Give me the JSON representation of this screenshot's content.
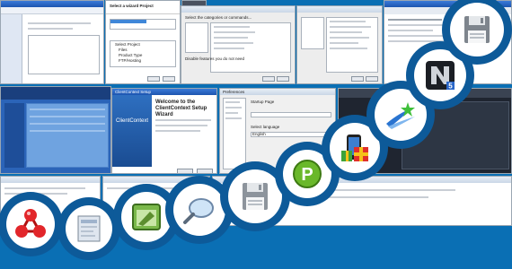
{
  "colors": {
    "background": "#0a6fb4",
    "ring": "#0d5a99",
    "window_titlebar": "#2a67c5"
  },
  "screens": {
    "project_wizard": {
      "title": "Select a wizard",
      "heading": "Select a wizard Project",
      "tree": [
        "Select Project",
        "Files",
        "Product Type",
        "FTP/Hosting"
      ]
    },
    "customize": {
      "question1": "Select the categories or commands...",
      "question2": "Disable features you do not need"
    },
    "setup": {
      "window_title": "ClientContext Setup",
      "logo_text": "ClientContext",
      "welcome_title": "Welcome to the ClientContext Setup Wizard",
      "buttons": [
        "Next >",
        "Cancel"
      ]
    },
    "preferences": {
      "window_title": "Preferences",
      "field1": "Startup Page",
      "field2": "Select language",
      "value": "English"
    }
  },
  "icons": [
    "molecule-icon",
    "document-scanner-icon",
    "green-app-window-icon",
    "magnifier-icon",
    "floppy-disk-icon",
    "green-p-circle-icon",
    "gift-box-phone-icon",
    "blue-swoosh-star-icon",
    "media-n5-icon",
    "floppy-save-icon"
  ]
}
